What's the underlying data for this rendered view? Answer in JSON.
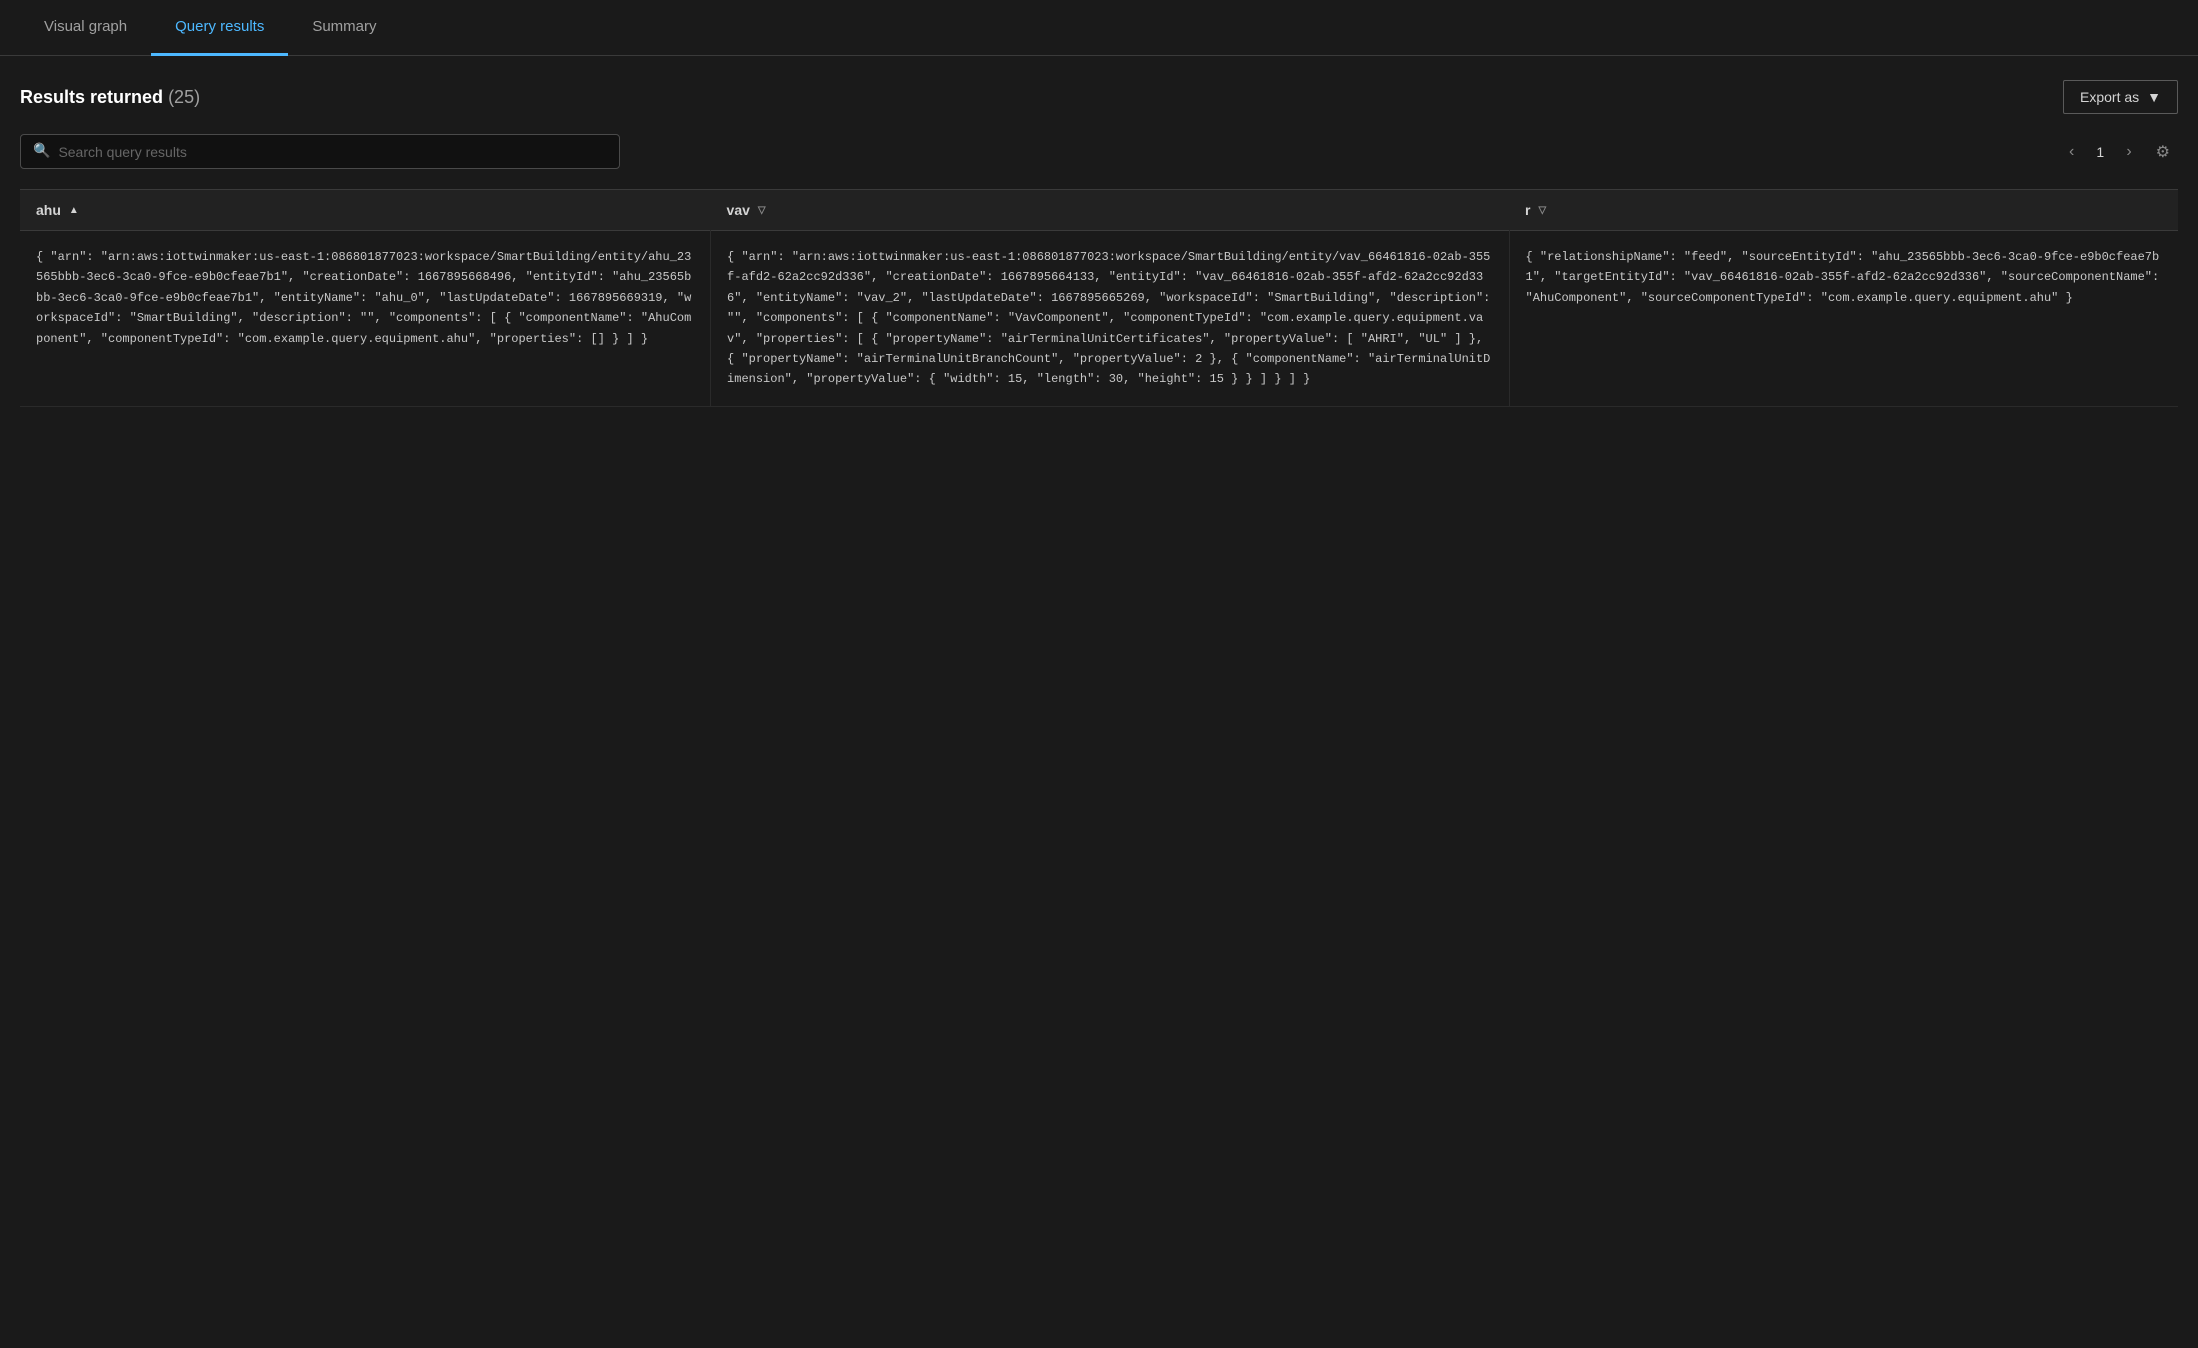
{
  "tabs": [
    {
      "id": "visual-graph",
      "label": "Visual graph",
      "active": false
    },
    {
      "id": "query-results",
      "label": "Query results",
      "active": true
    },
    {
      "id": "summary",
      "label": "Summary",
      "active": false
    }
  ],
  "results": {
    "title": "Results returned",
    "count": "(25)",
    "export_label": "Export as"
  },
  "search": {
    "placeholder": "Search query results"
  },
  "pagination": {
    "current_page": "1",
    "prev_label": "‹",
    "next_label": "›"
  },
  "columns": [
    {
      "id": "ahu",
      "label": "ahu",
      "sort": "asc"
    },
    {
      "id": "vav",
      "label": "vav",
      "sort": "desc"
    },
    {
      "id": "r",
      "label": "r",
      "sort": "desc"
    }
  ],
  "rows": [
    {
      "ahu": "{ \"arn\": \"arn:aws:iottwinmaker:us-east-1:086801877023:workspace/SmartBuilding/entity/ahu_23565bbb-3ec6-3ca0-9fce-e9b0cfeae7b1\", \"creationDate\": 1667895668496, \"entityId\": \"ahu_23565bbb-3ec6-3ca0-9fce-e9b0cfeae7b1\", \"entityName\": \"ahu_0\", \"lastUpdateDate\": 1667895669319, \"workspaceId\": \"SmartBuilding\", \"description\": \"\", \"components\": [ { \"componentName\": \"AhuComponent\", \"componentTypeId\": \"com.example.query.equipment.ahu\", \"properties\": [] } ] }",
      "vav": "{ \"arn\": \"arn:aws:iottwinmaker:us-east-1:086801877023:workspace/SmartBuilding/entity/vav_66461816-02ab-355f-afd2-62a2cc92d336\", \"creationDate\": 1667895664133, \"entityId\": \"vav_66461816-02ab-355f-afd2-62a2cc92d336\", \"entityName\": \"vav_2\", \"lastUpdateDate\": 1667895665269, \"workspaceId\": \"SmartBuilding\", \"description\": \"\", \"components\": [ { \"componentName\": \"VavComponent\", \"componentTypeId\": \"com.example.query.equipment.vav\", \"properties\": [ { \"propertyName\": \"airTerminalUnitCertificates\", \"propertyValue\": [ \"AHRI\", \"UL\" ] }, { \"propertyName\": \"airTerminalUnitBranchCount\", \"propertyValue\": 2 }, { \"componentName\": \"airTerminalUnitDimension\", \"propertyValue\": { \"width\": 15, \"length\": 30, \"height\": 15 } } ] } ] }",
      "r": "{ \"relationshipName\": \"feed\", \"sourceEntityId\": \"ahu_23565bbb-3ec6-3ca0-9fce-e9b0cfeae7b1\", \"targetEntityId\": \"vav_66461816-02ab-355f-afd2-62a2cc92d336\", \"sourceComponentName\": \"AhuComponent\", \"sourceComponentTypeId\": \"com.example.query.equipment.ahu\" }"
    }
  ]
}
